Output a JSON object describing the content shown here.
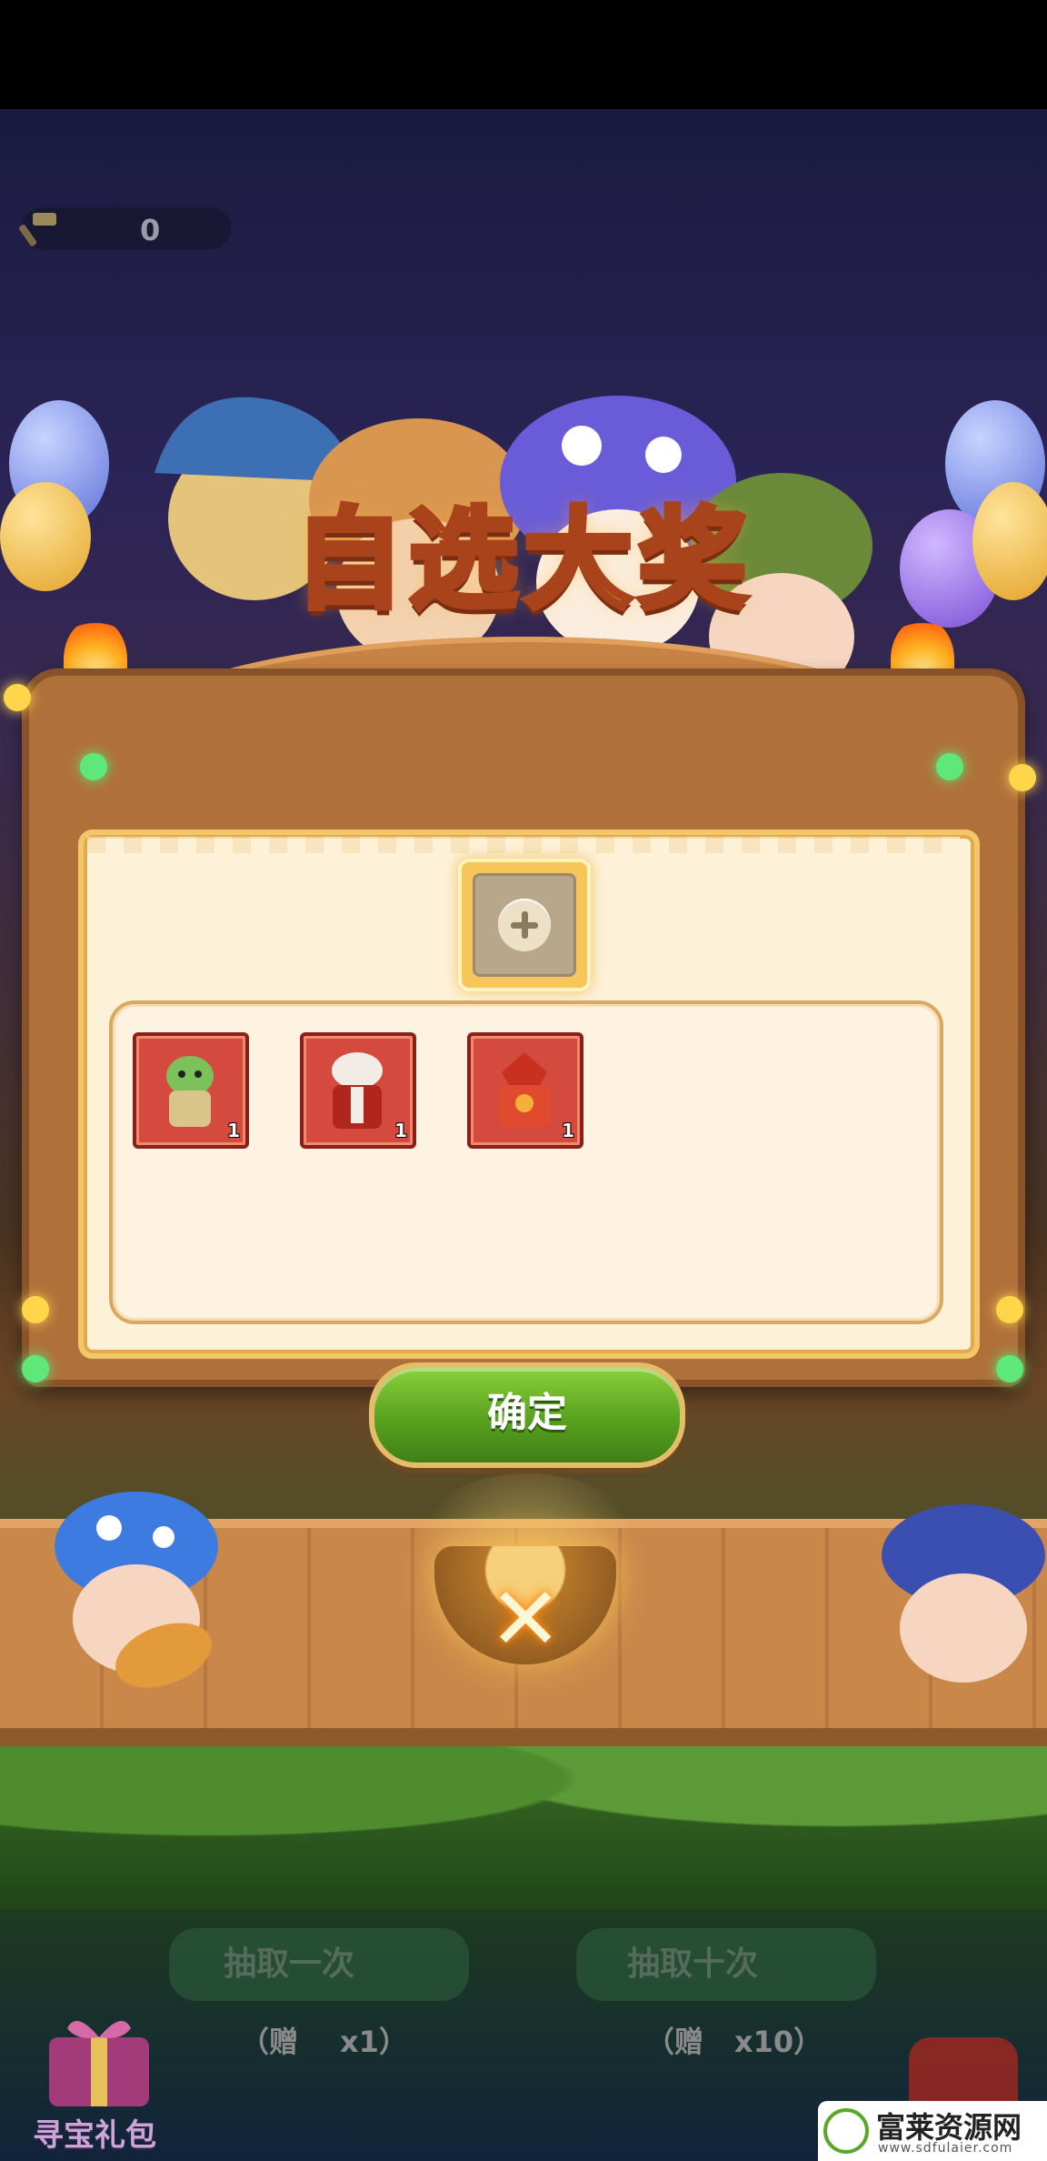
{
  "hud": {
    "ticket_count": "0"
  },
  "dialog": {
    "title": "自选大奖",
    "selected_slot": {
      "icon": "plus-icon"
    },
    "rewards": [
      {
        "name": "green-goblin-hero",
        "qty": "1"
      },
      {
        "name": "white-haired-warrior-hero",
        "qty": "1"
      },
      {
        "name": "red-armored-hero",
        "qty": "1"
      }
    ],
    "confirm_label": "确定",
    "close_icon": "close-x-icon"
  },
  "background": {
    "draw_once_label": "抽取一次",
    "draw_ten_label": "抽取十次",
    "cost_once": "（赠",
    "cost_once_qty": "x1）",
    "cost_ten": "（赠",
    "cost_ten_qty": "x10）",
    "gift_pack_label": "寻宝礼包"
  },
  "watermark": {
    "main": "富莱资源网",
    "sub": "www.sdfulaier.com"
  },
  "colors": {
    "title": "#ffcf46",
    "confirm_green": "#58a21f",
    "panel": "#fdf1d8",
    "item_bg": "#d54a3f"
  }
}
